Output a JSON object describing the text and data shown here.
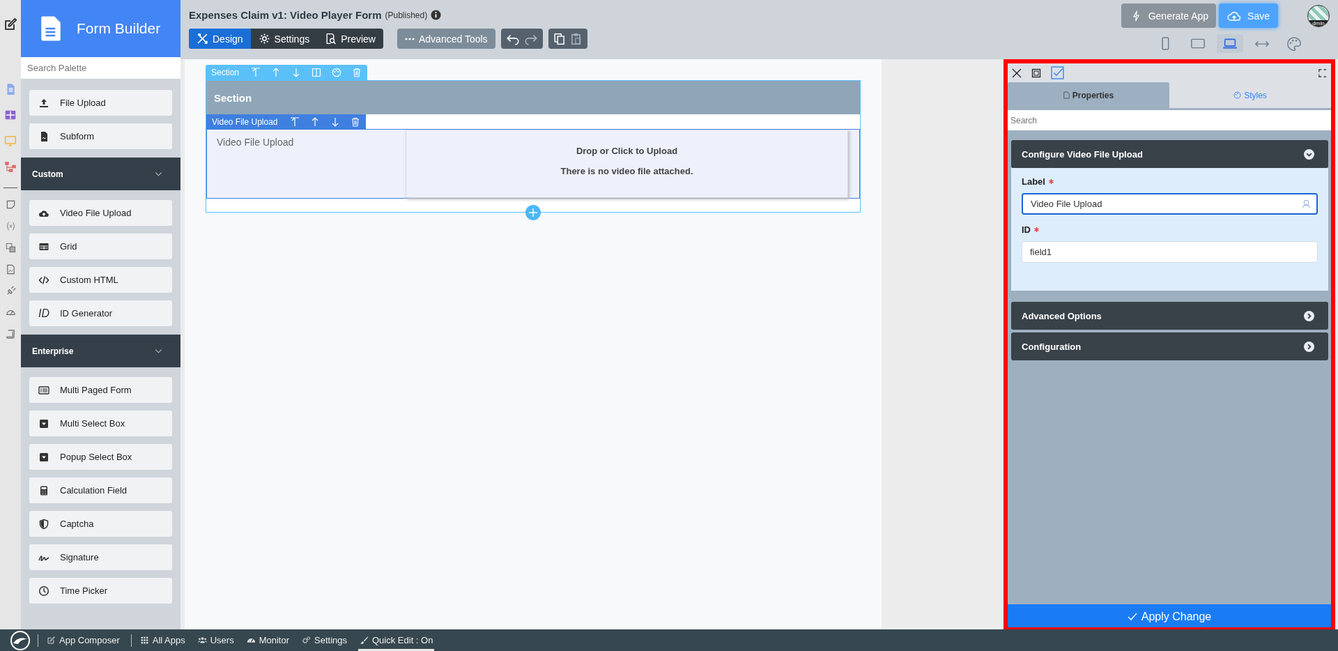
{
  "palette": {
    "title": "Form Builder",
    "search_placeholder": "Search Palette",
    "groups": [
      {
        "items": [
          {
            "label": "File Upload"
          },
          {
            "label": "Subform"
          }
        ]
      },
      {
        "title": "Custom",
        "expanded": true,
        "items": [
          {
            "label": "Video File Upload"
          },
          {
            "label": "Grid"
          },
          {
            "label": "Custom HTML"
          },
          {
            "label": "ID Generator",
            "badge": "ID"
          }
        ]
      },
      {
        "title": "Enterprise",
        "expanded": true,
        "items": [
          {
            "label": "Multi Paged Form"
          },
          {
            "label": "Multi Select Box"
          },
          {
            "label": "Popup Select Box"
          },
          {
            "label": "Calculation Field"
          },
          {
            "label": "Captcha"
          },
          {
            "label": "Signature"
          },
          {
            "label": "Time Picker"
          }
        ]
      }
    ]
  },
  "header": {
    "title": "Expenses Claim v1: Video Player Form",
    "status": "(Published)",
    "modes": [
      {
        "label": "Design",
        "selected": true
      },
      {
        "label": "Settings",
        "selected": false
      },
      {
        "label": "Preview",
        "selected": false
      }
    ],
    "advanced": "Advanced Tools",
    "generate": "Generate App",
    "save": "Save",
    "user": "dmin",
    "devices": [
      {
        "selected": false
      },
      {
        "selected": false
      },
      {
        "selected": true
      },
      {
        "selected": false
      },
      {
        "selected": false
      }
    ]
  },
  "canvas": {
    "section_toolbar": "Section",
    "section_title": "Section",
    "field_toolbar": "Video File Upload",
    "field_label": "Video File Upload",
    "drop_text": "Drop or Click to Upload",
    "empty_text": "There is no video file attached."
  },
  "properties": {
    "tabs": [
      {
        "label": "Properties",
        "selected": true
      },
      {
        "label": "Styles",
        "selected": false
      }
    ],
    "search_placeholder": "Search",
    "sections": [
      {
        "title": "Configure Video File Upload",
        "expanded": true,
        "fields": [
          {
            "label": "Label",
            "required": true,
            "value": "Video File Upload",
            "focused": true
          },
          {
            "label": "ID",
            "required": true,
            "value": "field1",
            "focused": false
          }
        ]
      },
      {
        "title": "Advanced Options",
        "expanded": false
      },
      {
        "title": "Configuration",
        "expanded": false
      }
    ],
    "apply": "Apply Change"
  },
  "bottom_bar": [
    {
      "label": "App Composer",
      "selected": false
    },
    {
      "label": "All Apps",
      "selected": false
    },
    {
      "label": "Users",
      "selected": false
    },
    {
      "label": "Monitor",
      "selected": false
    },
    {
      "label": "Settings",
      "selected": false
    },
    {
      "label": "Quick Edit : On",
      "selected": true
    }
  ]
}
